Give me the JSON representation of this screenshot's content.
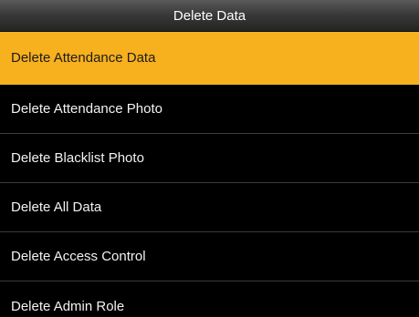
{
  "header": {
    "title": "Delete Data"
  },
  "menu": {
    "selected_index": 0,
    "items": [
      {
        "label": "Delete Attendance Data"
      },
      {
        "label": "Delete Attendance Photo"
      },
      {
        "label": "Delete Blacklist Photo"
      },
      {
        "label": "Delete All Data"
      },
      {
        "label": "Delete Access Control"
      },
      {
        "label": "Delete Admin Role"
      }
    ]
  },
  "colors": {
    "highlight": "#f7b01e",
    "background": "#000000",
    "text": "#f2f2f2",
    "divider": "#3c3c3c"
  }
}
